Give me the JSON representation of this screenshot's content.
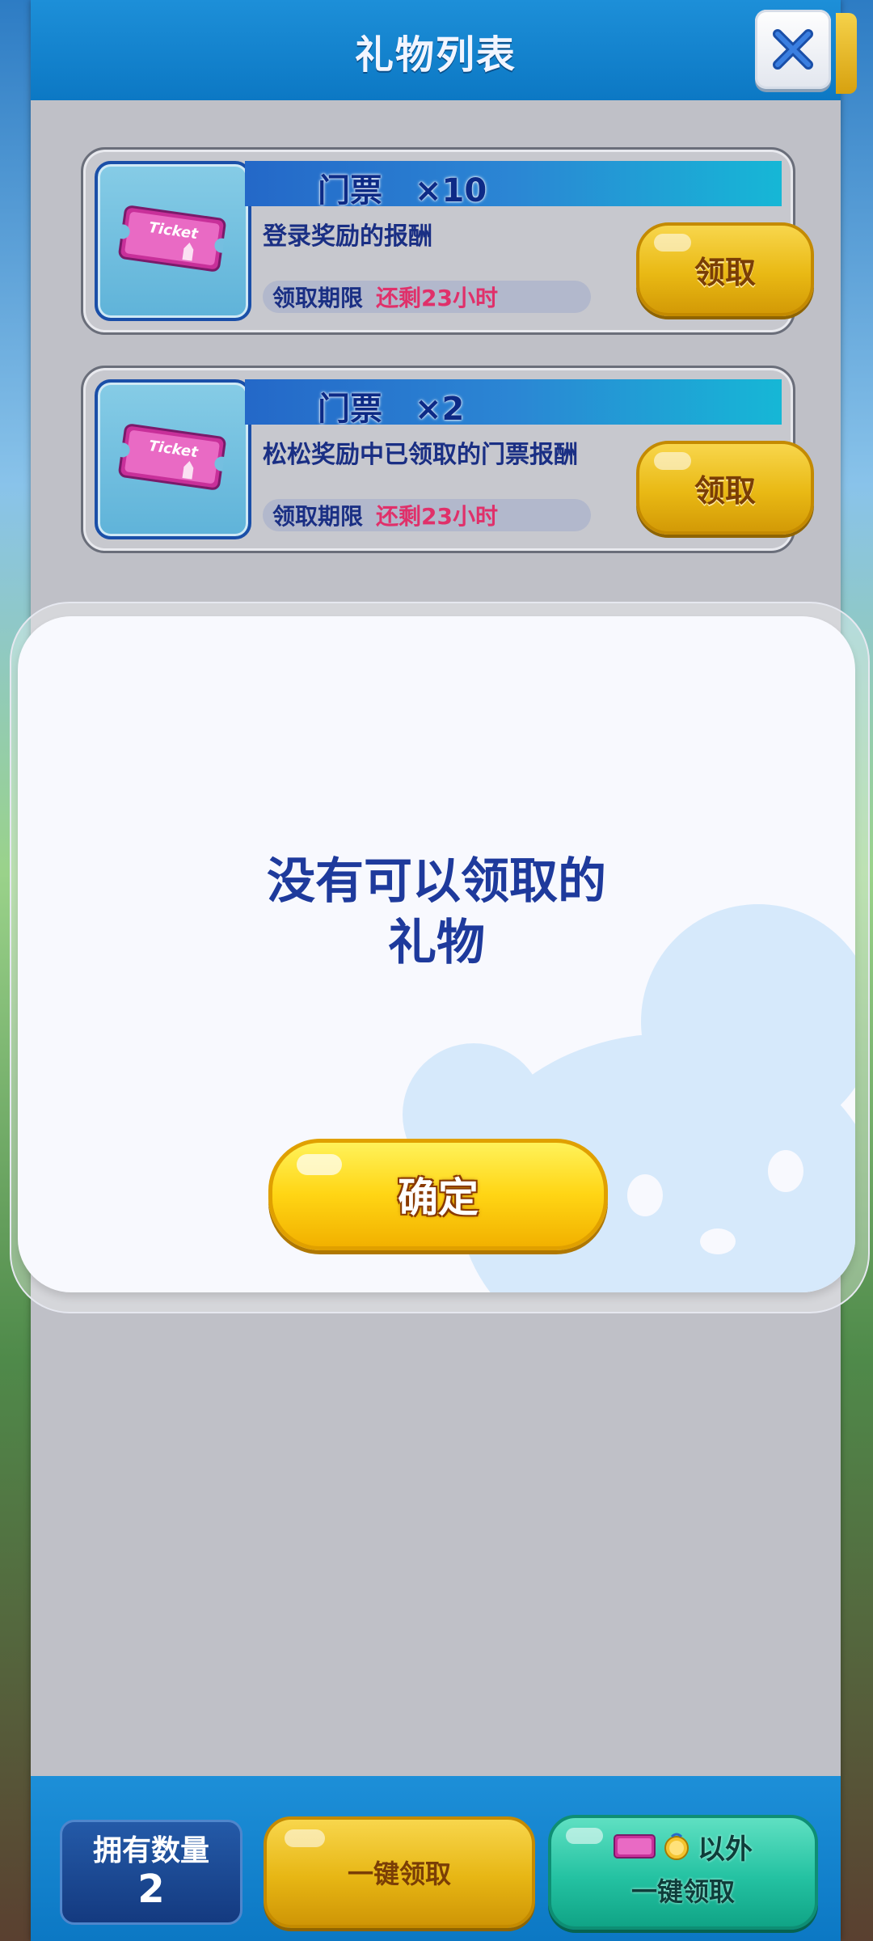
{
  "header": {
    "title": "礼物列表"
  },
  "gifts": [
    {
      "name": "门票　×10",
      "description": "登录奖励的报酬",
      "expiry_label": "领取期限",
      "expiry_remaining": "还剩23小时",
      "claim_label": "领取",
      "ticket_text": "Ticket"
    },
    {
      "name": "门票　×2",
      "description": "松松奖励中已领取的门票报酬",
      "expiry_label": "领取期限",
      "expiry_remaining": "还剩23小时",
      "claim_label": "领取",
      "ticket_text": "Ticket"
    }
  ],
  "modal": {
    "message": "没有可以领取的\n礼物",
    "confirm_label": "确定"
  },
  "footer": {
    "count_label": "拥有数量",
    "count_value": "2",
    "claim_all_label": "一键领取",
    "except_label": "以外",
    "except_claim_label": "一键领取"
  },
  "icons": [
    "close-icon",
    "ticket-icon",
    "coin-icon"
  ],
  "colors": {
    "header_blue": "#0c78c4",
    "claim_gold": "#e9b914",
    "confirm_yellow": "#ffd514",
    "text_navy": "#1e3a9c",
    "remaining_pink": "#e0306a",
    "teal_button": "#24c2a2"
  }
}
